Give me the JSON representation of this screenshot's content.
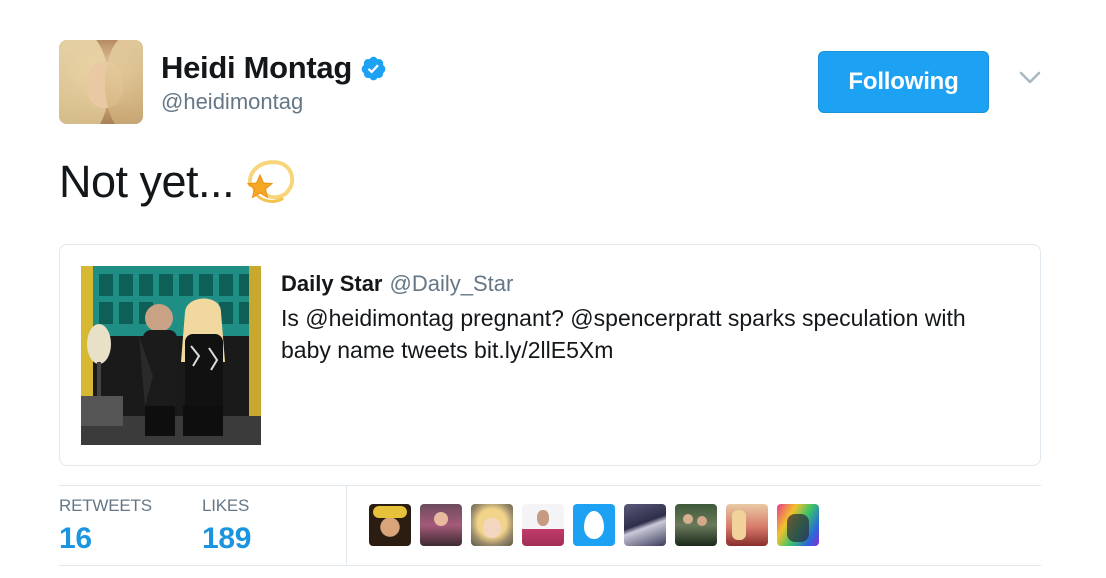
{
  "author": {
    "display_name": "Heidi Montag",
    "handle": "@heidimontag",
    "verified": true,
    "follow_button_label": "Following"
  },
  "tweet": {
    "text": "Not yet...",
    "emoji": "dizzy"
  },
  "quoted_tweet": {
    "author_name": "Daily Star",
    "author_handle": "@Daily_Star",
    "text": "Is @heidimontag pregnant? @spencerpratt sparks speculation with baby name tweets bit.ly/2llE5Xm"
  },
  "stats": {
    "retweets_label": "RETWEETS",
    "retweets_count": "16",
    "likes_label": "LIKES",
    "likes_count": "189"
  },
  "likers": [
    {
      "avatar": "user-photo"
    },
    {
      "avatar": "user-photo"
    },
    {
      "avatar": "user-photo"
    },
    {
      "avatar": "user-photo"
    },
    {
      "avatar": "default-egg"
    },
    {
      "avatar": "user-photo"
    },
    {
      "avatar": "user-photo"
    },
    {
      "avatar": "user-photo"
    },
    {
      "avatar": "user-photo"
    }
  ],
  "colors": {
    "brand_blue": "#1da1f2",
    "link_blue": "#1b95e0",
    "secondary_text": "#657786",
    "border": "#e1e8ed"
  }
}
